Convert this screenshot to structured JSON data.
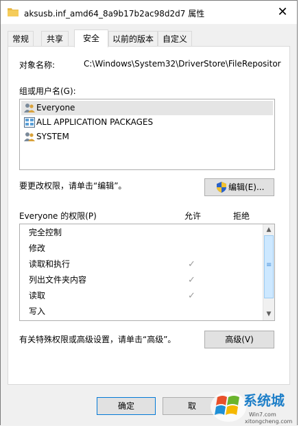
{
  "window": {
    "title": "aksusb.inf_amd64_8a9b17b2ac98d2d7 属性",
    "close_glyph": "✕"
  },
  "tabs": [
    {
      "label": "常规"
    },
    {
      "label": "共享"
    },
    {
      "label": "安全"
    },
    {
      "label": "以前的版本"
    },
    {
      "label": "自定义"
    }
  ],
  "active_tab": "安全",
  "security": {
    "object_name_label": "对象名称:",
    "object_name_value": "C:\\Windows\\System32\\DriverStore\\FileRepositor",
    "groups_label": "组或用户名(G):",
    "groups": [
      {
        "name": "Everyone",
        "icon": "users-icon",
        "selected": true
      },
      {
        "name": "ALL APPLICATION PACKAGES",
        "icon": "packages-icon",
        "selected": false
      },
      {
        "name": "SYSTEM",
        "icon": "users-icon",
        "selected": false
      }
    ],
    "edit_hint": "要更改权限，请单击“编辑”。",
    "edit_button": "编辑(E)...",
    "permissions_title": "Everyone 的权限(P)",
    "allow_header": "允许",
    "deny_header": "拒绝",
    "check_glyph": "✓",
    "permissions": [
      {
        "name": "完全控制",
        "allow": false,
        "deny": false
      },
      {
        "name": "修改",
        "allow": false,
        "deny": false
      },
      {
        "name": "读取和执行",
        "allow": true,
        "deny": false
      },
      {
        "name": "列出文件夹内容",
        "allow": true,
        "deny": false
      },
      {
        "name": "读取",
        "allow": true,
        "deny": false
      },
      {
        "name": "写入",
        "allow": false,
        "deny": false
      }
    ],
    "advanced_hint": "有关特殊权限或高级设置，请单击“高级”。",
    "advanced_button": "高级(V)"
  },
  "footer": {
    "ok_button": "确定",
    "cancel_button": "取"
  },
  "watermark": {
    "brand": "系统城",
    "url1": "Win7.com",
    "url2": "xitongcheng.com"
  },
  "colors": {
    "folder": "#e8b842",
    "focus": "#0078d7",
    "checkmark": "#9a9a9a"
  }
}
